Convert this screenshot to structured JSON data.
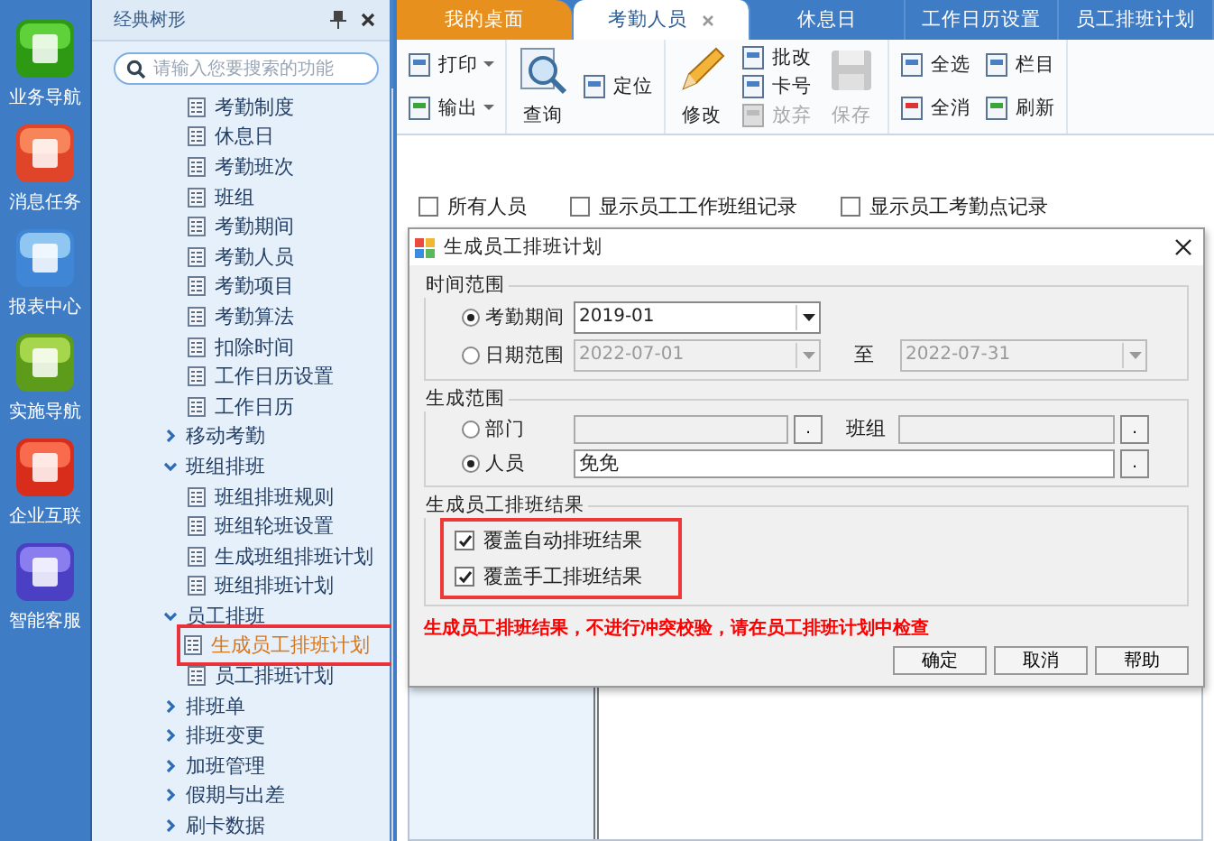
{
  "nav": {
    "items": [
      {
        "label": "业务导航"
      },
      {
        "label": "消息任务"
      },
      {
        "label": "报表中心"
      },
      {
        "label": "实施导航"
      },
      {
        "label": "企业互联"
      },
      {
        "label": "智能客服"
      }
    ]
  },
  "sidebar": {
    "title": "经典树形",
    "search": {
      "placeholder": "请输入您要搜索的功能"
    },
    "tree": [
      {
        "label": "考勤制度",
        "kind": "leaf",
        "selected": false,
        "highlighted": false
      },
      {
        "label": "休息日",
        "kind": "leaf",
        "selected": false,
        "highlighted": false
      },
      {
        "label": "考勤班次",
        "kind": "leaf",
        "selected": false,
        "highlighted": false
      },
      {
        "label": "班组",
        "kind": "leaf",
        "selected": false,
        "highlighted": false
      },
      {
        "label": "考勤期间",
        "kind": "leaf",
        "selected": false,
        "highlighted": false
      },
      {
        "label": "考勤人员",
        "kind": "leaf",
        "selected": false,
        "highlighted": false
      },
      {
        "label": "考勤项目",
        "kind": "leaf",
        "selected": false,
        "highlighted": false
      },
      {
        "label": "考勤算法",
        "kind": "leaf",
        "selected": false,
        "highlighted": false
      },
      {
        "label": "扣除时间",
        "kind": "leaf",
        "selected": false,
        "highlighted": false
      },
      {
        "label": "工作日历设置",
        "kind": "leaf",
        "selected": false,
        "highlighted": false
      },
      {
        "label": "工作日历",
        "kind": "leaf",
        "selected": false,
        "highlighted": false
      },
      {
        "label": "移动考勤",
        "kind": "group",
        "expanded": false
      },
      {
        "label": "班组排班",
        "kind": "group",
        "expanded": true,
        "children": [
          {
            "label": "班组排班规则",
            "kind": "leaf",
            "selected": false,
            "highlighted": false
          },
          {
            "label": "班组轮班设置",
            "kind": "leaf",
            "selected": false,
            "highlighted": false
          },
          {
            "label": "生成班组排班计划",
            "kind": "leaf",
            "selected": false,
            "highlighted": false
          },
          {
            "label": "班组排班计划",
            "kind": "leaf",
            "selected": false,
            "highlighted": false
          }
        ]
      },
      {
        "label": "员工排班",
        "kind": "group",
        "expanded": true,
        "children": [
          {
            "label": "生成员工排班计划",
            "kind": "leaf",
            "selected": true,
            "highlighted": true
          },
          {
            "label": "员工排班计划",
            "kind": "leaf",
            "selected": false,
            "highlighted": false
          }
        ]
      },
      {
        "label": "排班单",
        "kind": "group",
        "expanded": false
      },
      {
        "label": "排班变更",
        "kind": "group",
        "expanded": false
      },
      {
        "label": "加班管理",
        "kind": "group",
        "expanded": false
      },
      {
        "label": "假期与出差",
        "kind": "group",
        "expanded": false
      },
      {
        "label": "刷卡数据",
        "kind": "group",
        "expanded": false
      }
    ]
  },
  "tabs": [
    {
      "label": "我的桌面",
      "kind": "home",
      "selected": false,
      "closable": false
    },
    {
      "label": "考勤人员",
      "kind": "page",
      "selected": true,
      "closable": true
    },
    {
      "label": "休息日",
      "kind": "page",
      "selected": false,
      "closable": false
    },
    {
      "label": "工作日历设置",
      "kind": "page",
      "selected": false,
      "closable": false
    },
    {
      "label": "员工排班计划",
      "kind": "page",
      "selected": false,
      "closable": false
    }
  ],
  "toolbar": {
    "groups": [
      {
        "columns": [
          [
            {
              "label": "打印",
              "kind": "small",
              "disabled": false,
              "dropdown": true
            },
            {
              "label": "输出",
              "kind": "small",
              "disabled": false,
              "dropdown": true
            }
          ]
        ]
      },
      {
        "columns": [
          [
            {
              "label": "查询",
              "kind": "large",
              "disabled": false,
              "dropdown": false
            }
          ],
          [
            {
              "label": "定位",
              "kind": "small",
              "disabled": false,
              "dropdown": false
            }
          ]
        ]
      },
      {
        "columns": [
          [
            {
              "label": "修改",
              "kind": "large",
              "disabled": false,
              "dropdown": false
            }
          ],
          [
            {
              "label": "批改",
              "kind": "small",
              "disabled": false,
              "dropdown": false
            },
            {
              "label": "卡号",
              "kind": "small",
              "disabled": false,
              "dropdown": false
            },
            {
              "label": "放弃",
              "kind": "small",
              "disabled": true,
              "dropdown": false
            }
          ],
          [
            {
              "label": "保存",
              "kind": "large",
              "disabled": true,
              "dropdown": false
            }
          ]
        ]
      },
      {
        "columns": [
          [
            {
              "label": "全选",
              "kind": "small",
              "disabled": false,
              "dropdown": false
            },
            {
              "label": "全消",
              "kind": "small",
              "disabled": false,
              "dropdown": false
            }
          ],
          [
            {
              "label": "栏目",
              "kind": "small",
              "disabled": false,
              "dropdown": false
            },
            {
              "label": "刷新",
              "kind": "small",
              "disabled": false,
              "dropdown": false
            }
          ]
        ]
      }
    ]
  },
  "filters": [
    {
      "label": "所有人员",
      "checked": false
    },
    {
      "label": "显示员工工作班组记录",
      "checked": false
    },
    {
      "label": "显示员工考勤点记录",
      "checked": false
    }
  ],
  "dialog": {
    "title": "生成员工排班计划",
    "time_range": {
      "title": "时间范围",
      "period": {
        "label": "考勤期间",
        "selected": true,
        "value": "2019-01"
      },
      "dates": {
        "label": "日期范围",
        "selected": false,
        "from": "2022-07-01",
        "separator": "至",
        "to": "2022-07-31"
      }
    },
    "scope": {
      "title": "生成范围",
      "department": {
        "label": "部门",
        "selected": false,
        "button": "."
      },
      "team": {
        "label": "班组",
        "button": "."
      },
      "person": {
        "label": "人员",
        "selected": true,
        "value": "免免",
        "button": "."
      }
    },
    "result": {
      "title": "生成员工排班结果",
      "highlighted": true,
      "options": [
        {
          "label": "覆盖自动排班结果",
          "checked": true
        },
        {
          "label": "覆盖手工排班结果",
          "checked": true
        }
      ]
    },
    "warning": "生成员工排班结果，不进行冲突校验，请在员工排班计划中检查",
    "buttons": [
      "确定",
      "取消",
      "帮助"
    ]
  }
}
